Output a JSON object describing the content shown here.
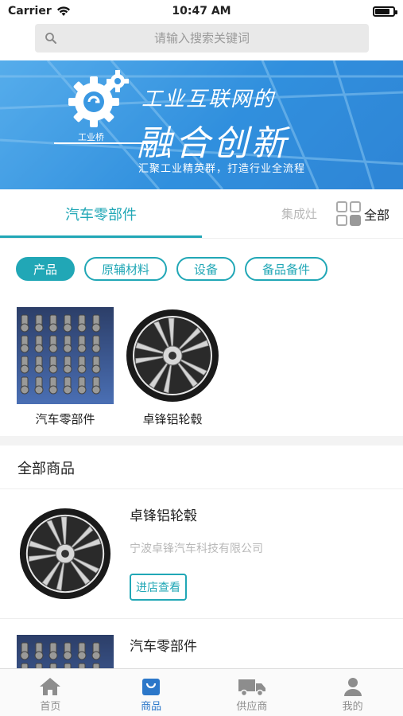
{
  "status_bar": {
    "carrier": "Carrier",
    "time": "10:47 AM"
  },
  "search": {
    "placeholder": "请输入搜索关键词"
  },
  "banner": {
    "title_line1": "工业互联网的",
    "title_line2": "融合创新",
    "subtitle": "汇聚工业精英群，打造行业全流程",
    "brand": "工业桥"
  },
  "category_tabs": {
    "main": "汽车零部件",
    "secondary": "集成灶",
    "all": "全部"
  },
  "filter_pills": [
    {
      "label": "产品",
      "active": true
    },
    {
      "label": "原辅材料",
      "active": false
    },
    {
      "label": "设备",
      "active": false
    },
    {
      "label": "备品备件",
      "active": false
    }
  ],
  "category_items": [
    {
      "label": "汽车零部件",
      "image": "auto-parts-tray"
    },
    {
      "label": "卓锋铝轮毂",
      "image": "alloy-wheel"
    }
  ],
  "all_goods": {
    "title": "全部商品",
    "items": [
      {
        "name": "卓锋铝轮毂",
        "shop": "宁波卓锋汽车科技有限公司",
        "button": "进店查看",
        "image": "alloy-wheel"
      },
      {
        "name": "汽车零部件",
        "image": "auto-parts-tray"
      }
    ]
  },
  "bottom_nav": [
    {
      "label": "首页",
      "icon": "home-icon",
      "active": false
    },
    {
      "label": "商品",
      "icon": "bag-icon",
      "active": true
    },
    {
      "label": "供应商",
      "icon": "truck-icon",
      "active": false
    },
    {
      "label": "我的",
      "icon": "person-icon",
      "active": false
    }
  ],
  "colors": {
    "accent": "#21a7b6",
    "nav_active": "#2b77c9",
    "banner_blue": "#2d8ddc"
  }
}
